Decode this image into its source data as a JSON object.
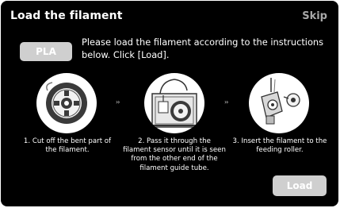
{
  "header": {
    "title": "Load the filament",
    "skip_label": "Skip"
  },
  "material": {
    "label": "PLA"
  },
  "instructions": "Please load the filament according to the instructions below. Click [Load].",
  "steps": [
    {
      "text": "1. Cut off the bent part of the filament.",
      "image_icon": "filament-spool-icon"
    },
    {
      "text": "2. Pass it through the filament sensor until it is seen from the other end of the filament guide tube.",
      "image_icon": "printer-filament-sensor-icon"
    },
    {
      "text": "3. Insert the filament to the feeding roller.",
      "image_icon": "extruder-feeding-roller-icon"
    }
  ],
  "arrow_glyph": "››",
  "actions": {
    "load_label": "Load"
  },
  "colors": {
    "background": "#000000",
    "button": "#cfcfcf",
    "text": "#ffffff",
    "skip": "#a8a8a8"
  }
}
